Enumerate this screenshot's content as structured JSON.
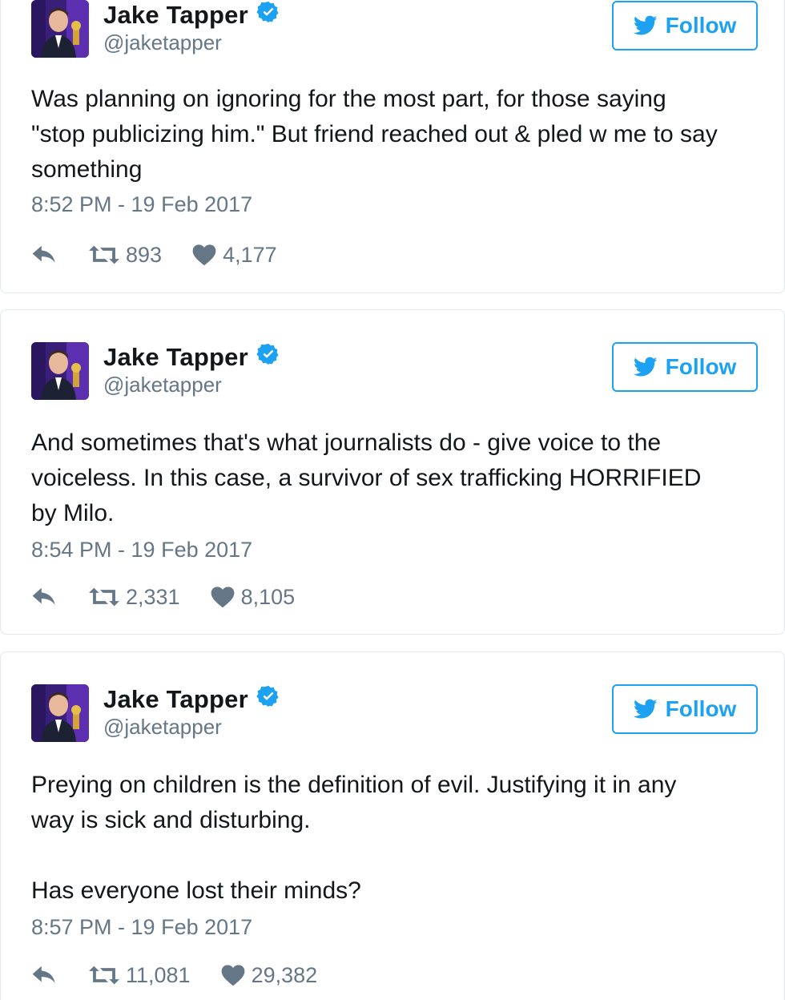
{
  "colors": {
    "brand_blue": "#1da1f2",
    "muted_gray": "#657786",
    "text": "#14171a",
    "border": "#e1e8ed"
  },
  "icons": {
    "reply": "reply-icon",
    "retweet": "retweet-icon",
    "like": "heart-icon",
    "verified": "verified-badge-icon",
    "follow": "twitter-bird-icon"
  },
  "tweets": [
    {
      "display_name": "Jake Tapper",
      "handle": "@jaketapper",
      "follow_label": "Follow",
      "text": "Was planning on ignoring for the most part, for those saying\n\"stop publicizing him.\" But friend reached out & pled w me to say\nsomething",
      "timestamp": "8:52 PM - 19 Feb 2017",
      "retweets": "893",
      "likes": "4,177"
    },
    {
      "display_name": "Jake Tapper",
      "handle": "@jaketapper",
      "follow_label": "Follow",
      "text": "And sometimes that's what journalists do - give voice to the\nvoiceless. In this case, a survivor of sex trafficking HORRIFIED\nby Milo.",
      "timestamp": "8:54 PM - 19 Feb 2017",
      "retweets": "2,331",
      "likes": "8,105"
    },
    {
      "display_name": "Jake Tapper",
      "handle": "@jaketapper",
      "follow_label": "Follow",
      "text": "Preying on children is the definition of evil. Justifying it in any\nway is sick and disturbing.\n\nHas everyone lost their minds?",
      "timestamp": "8:57 PM - 19 Feb 2017",
      "retweets": "11,081",
      "likes": "29,382"
    }
  ]
}
